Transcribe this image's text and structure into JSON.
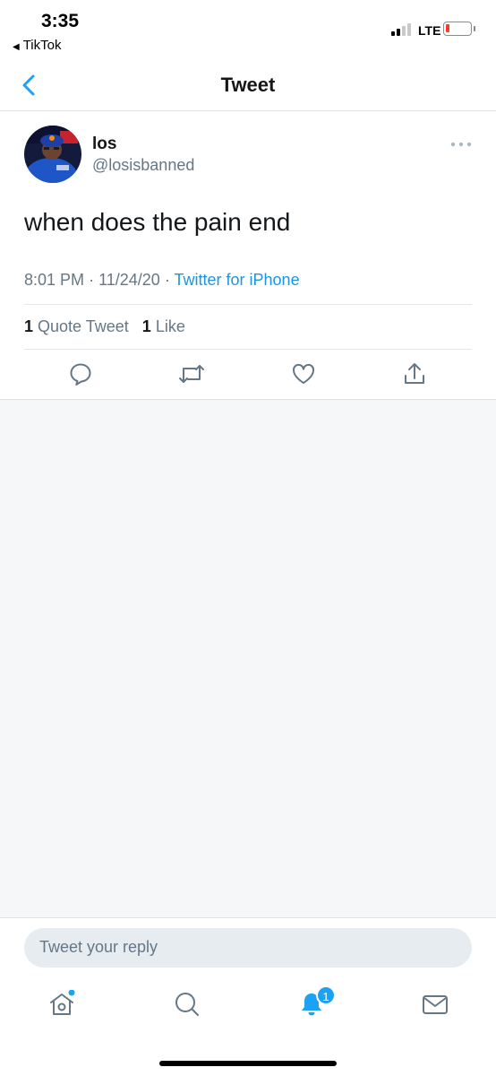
{
  "status_bar": {
    "time": "3:35",
    "back_app": "TikTok",
    "network": "LTE",
    "battery_level": 0.1,
    "signal_bars": 2
  },
  "nav": {
    "title": "Tweet",
    "back_icon": "chevron-left-icon",
    "accent_color": "#1da1f2"
  },
  "tweet": {
    "author_name": "los",
    "author_handle": "@losisbanned",
    "text": "when does the pain end",
    "time": "8:01 PM",
    "date": "11/24/20",
    "separator": "·",
    "source": "Twitter for iPhone",
    "quote_count": "1",
    "quote_label": "Quote Tweet",
    "like_count": "1",
    "like_label": "Like",
    "more_icon": "more-dots-icon",
    "actions": [
      "reply-icon",
      "retweet-icon",
      "like-icon",
      "share-icon"
    ]
  },
  "composer": {
    "placeholder": "Tweet your reply"
  },
  "tab_bar": {
    "tabs": [
      "home-icon",
      "search-icon",
      "notifications-icon",
      "messages-icon"
    ],
    "notification_badge": "1"
  }
}
